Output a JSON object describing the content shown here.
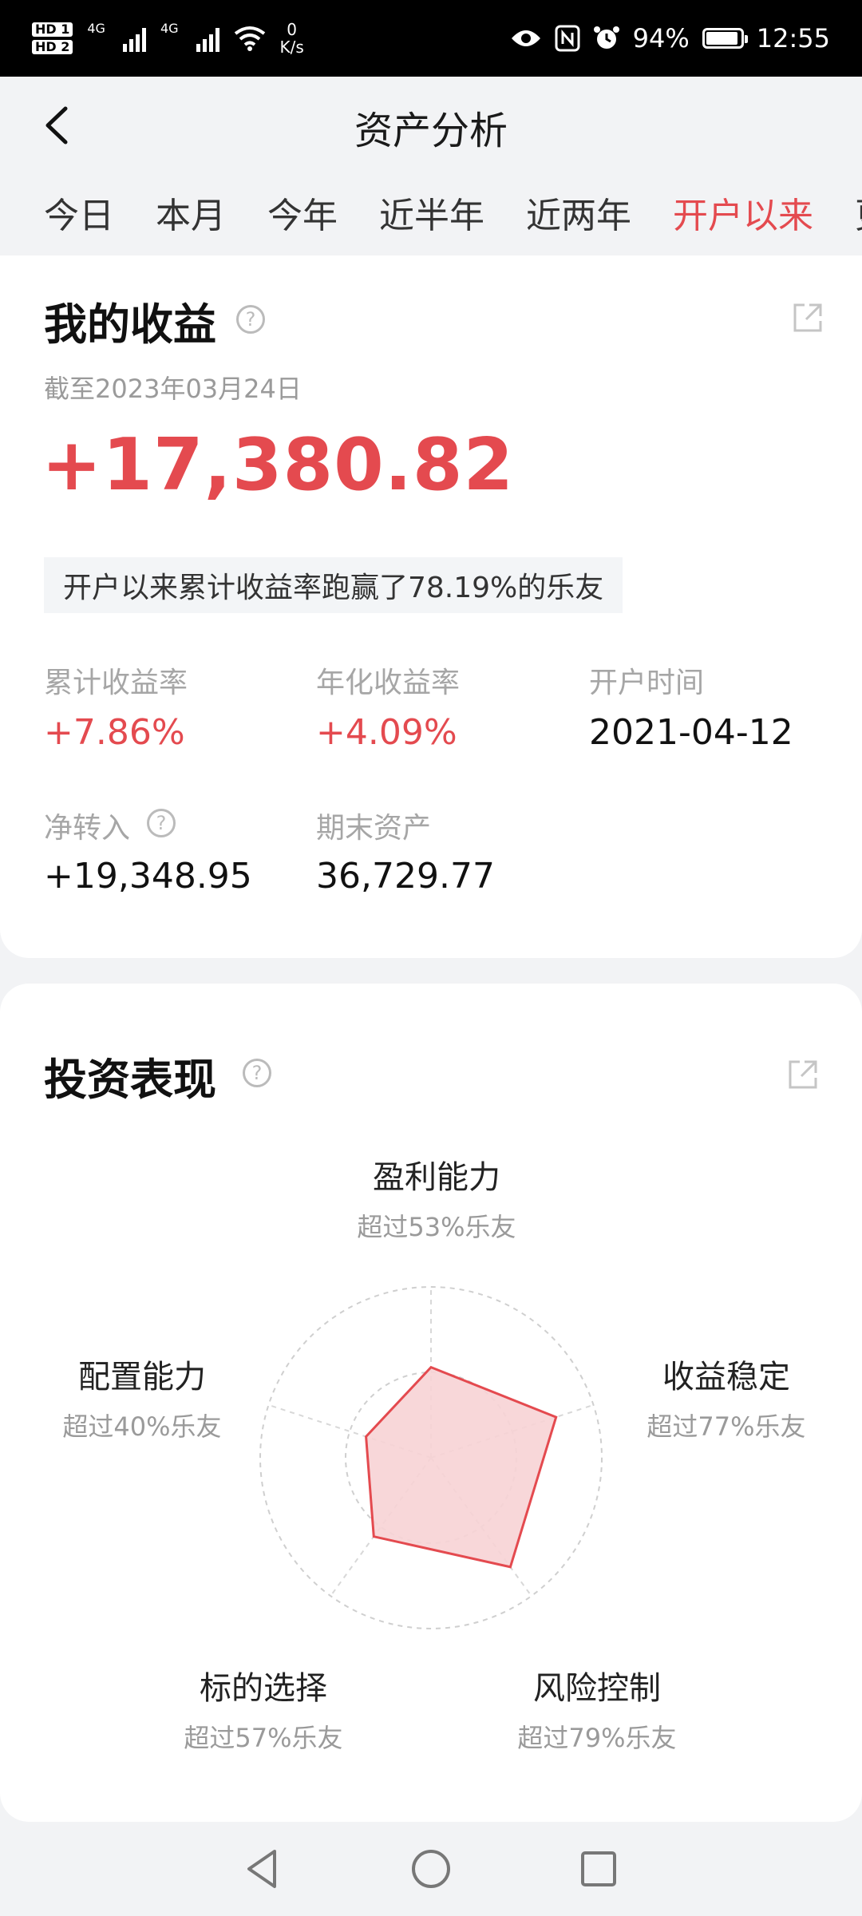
{
  "status_bar": {
    "hd1": "HD 1",
    "hd2": "HD 2",
    "net1": "4G",
    "net2": "4G",
    "speed_value": "0",
    "speed_unit": "K/s",
    "battery_percent": "94%",
    "battery_level": 0.94,
    "time": "12:55"
  },
  "header": {
    "title": "资产分析"
  },
  "tabs": [
    {
      "label": "今日",
      "active": false
    },
    {
      "label": "本月",
      "active": false
    },
    {
      "label": "今年",
      "active": false
    },
    {
      "label": "近半年",
      "active": false
    },
    {
      "label": "近两年",
      "active": false
    },
    {
      "label": "开户以来",
      "active": true
    },
    {
      "label": "更",
      "active": false
    }
  ],
  "earnings": {
    "title": "我的收益",
    "date": "截至2023年03月24日",
    "total": "+17,380.82",
    "beat_text": "开户以来累计收益率跑赢了78.19%的乐友",
    "cum_rate_label": "累计收益率",
    "cum_rate": "+7.86%",
    "annual_rate_label": "年化收益率",
    "annual_rate": "+4.09%",
    "open_date_label": "开户时间",
    "open_date": "2021-04-12",
    "net_in_label": "净转入",
    "net_in": "+19,348.95",
    "end_asset_label": "期末资产",
    "end_asset": "36,729.77"
  },
  "performance": {
    "title": "投资表现",
    "axes": [
      {
        "name": "盈利能力",
        "sub": "超过53%乐友",
        "value": 53
      },
      {
        "name": "收益稳定",
        "sub": "超过77%乐友",
        "value": 77
      },
      {
        "name": "风险控制",
        "sub": "超过79%乐友",
        "value": 79
      },
      {
        "name": "标的选择",
        "sub": "超过57%乐友",
        "value": 57
      },
      {
        "name": "配置能力",
        "sub": "超过40%乐友",
        "value": 40
      }
    ]
  },
  "colors": {
    "accent": "#e44a4f",
    "radar_fill": "#f7d3d5"
  }
}
